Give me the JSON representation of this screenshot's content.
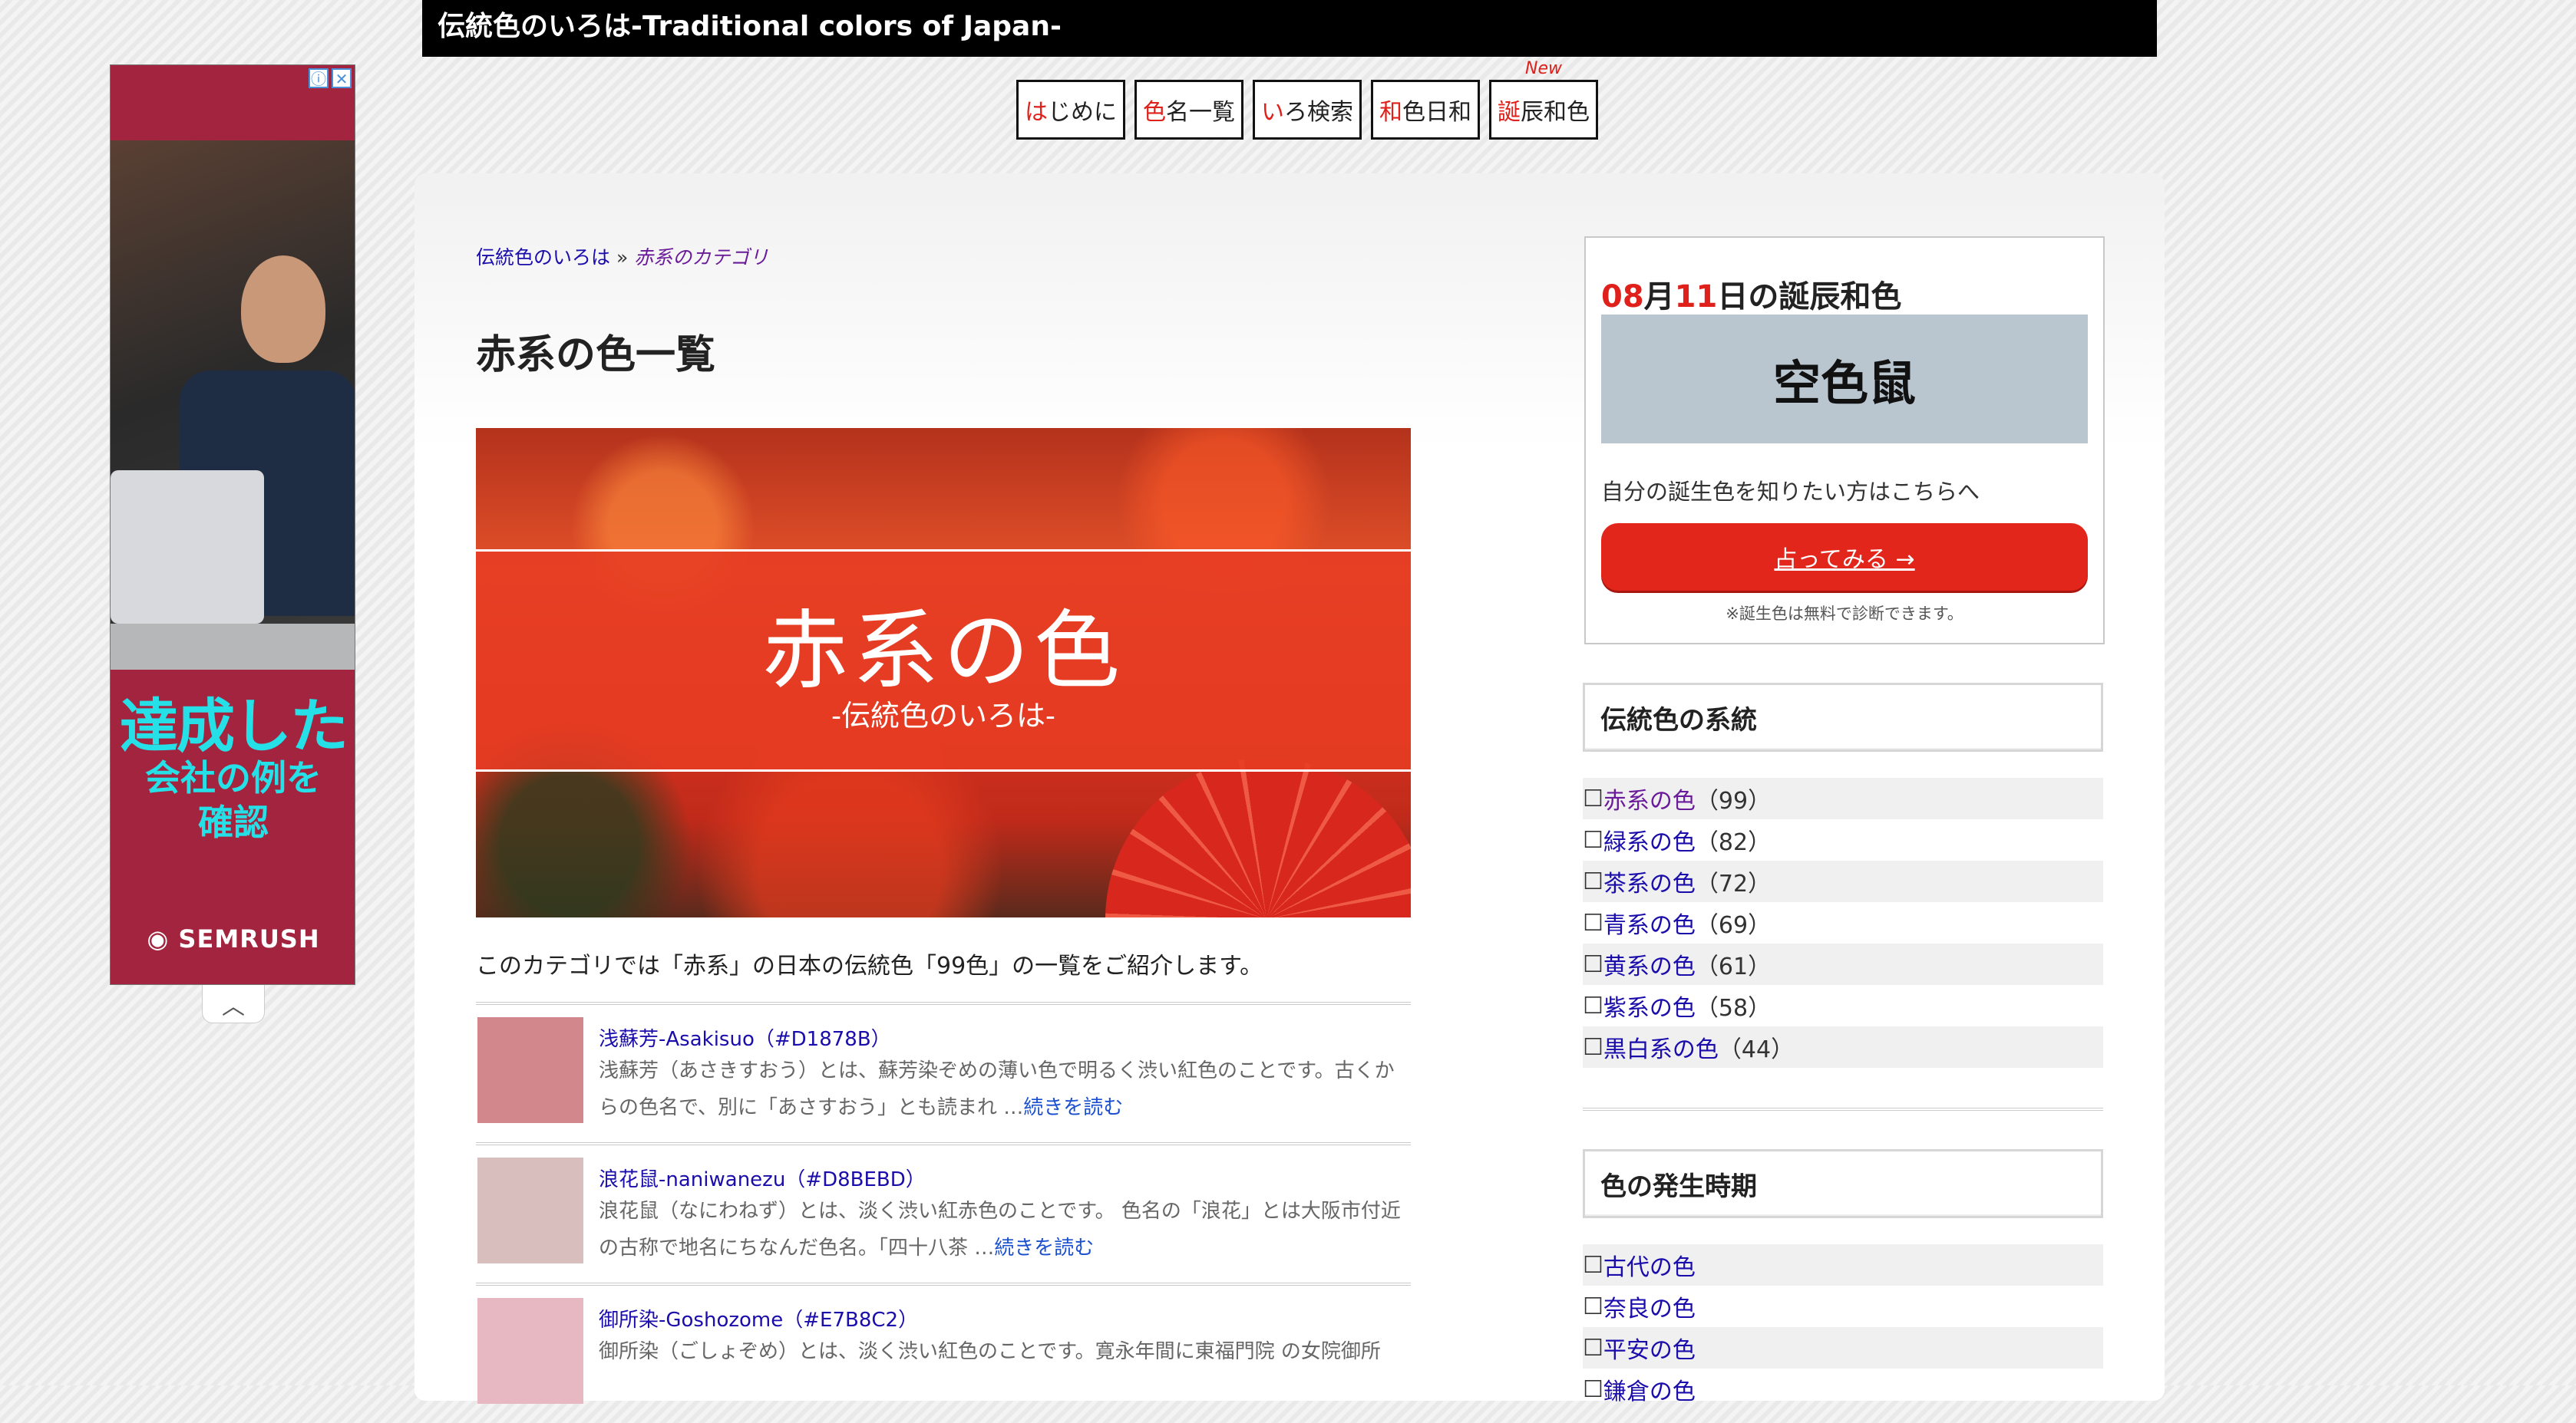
{
  "header": {
    "title": "伝統色のいろは-Traditional colors of Japan-"
  },
  "nav": {
    "items": [
      {
        "first": "は",
        "rest": "じめに"
      },
      {
        "first": "色",
        "rest": "名一覧"
      },
      {
        "first": "い",
        "rest": "ろ検索"
      },
      {
        "first": "和",
        "rest": "色日和"
      },
      {
        "first": "誕",
        "rest": "辰和色"
      }
    ],
    "new_label": "New"
  },
  "ad": {
    "headline1": "達成した",
    "headline2a": "会社の例を",
    "headline2b": "確認",
    "brand": "SEMRUSH",
    "info_glyph": "ⓘ",
    "close_glyph": "✕",
    "collapse_glyph": "︿"
  },
  "breadcrumb": {
    "home": "伝統色のいろは",
    "sep": " » ",
    "current": "赤系のカテゴリ"
  },
  "page_title": "赤系の色一覧",
  "hero": {
    "title": "赤系の色",
    "subtitle": "-伝統色のいろは-"
  },
  "intro": "このカテゴリでは「赤系」の日本の伝統色「99色」の一覧をご紹介します。",
  "colors": [
    {
      "name": "浅蘇芳-Asakisuo（#D1878B）",
      "hex": "#D1878B",
      "desc": "浅蘇芳（あさきすおう）とは、蘇芳染ぞめの薄い色で明るく渋い紅色のことです。古くからの色名で、別に「あさすおう」とも読まれ …",
      "more": "続きを読む"
    },
    {
      "name": "浪花鼠-naniwanezu（#D8BEBD）",
      "hex": "#D8BEBD",
      "desc": "浪花鼠（なにわねず）とは、淡く渋い紅赤色のことです。 色名の「浪花」とは大阪市付近の古称で地名にちなんだ色名。「四十八茶 …",
      "more": "続きを読む"
    },
    {
      "name": "御所染-Goshozome（#E7B8C2）",
      "hex": "#E7B8C2",
      "desc": "御所染（ごしょぞめ）とは、淡く渋い紅色のことです。寛永年間に東福門院 の女院御所",
      "more": ""
    }
  ],
  "birthday": {
    "month": "08",
    "month_unit": "月",
    "day": "11",
    "day_unit": "日",
    "suffix": "の誕辰和色",
    "color_name": "空色鼠",
    "color_hex": "#b9c6d0",
    "text": "自分の誕生色を知りたい方はこちらへ",
    "button": "占ってみる →",
    "note": "※誕生色は無料で診断できます。"
  },
  "categories": {
    "title": "伝統色の系統",
    "items": [
      {
        "label": "赤系の色",
        "count": "（99）"
      },
      {
        "label": "緑系の色",
        "count": "（82）"
      },
      {
        "label": "茶系の色",
        "count": "（72）"
      },
      {
        "label": "青系の色",
        "count": "（69）"
      },
      {
        "label": "黄系の色",
        "count": "（61）"
      },
      {
        "label": "紫系の色",
        "count": "（58）"
      },
      {
        "label": "黒白系の色",
        "count": "（44）"
      }
    ]
  },
  "eras": {
    "title": "色の発生時期",
    "items": [
      {
        "label": "古代の色"
      },
      {
        "label": "奈良の色"
      },
      {
        "label": "平安の色"
      },
      {
        "label": "鎌倉の色"
      }
    ]
  },
  "bullet": "☐"
}
